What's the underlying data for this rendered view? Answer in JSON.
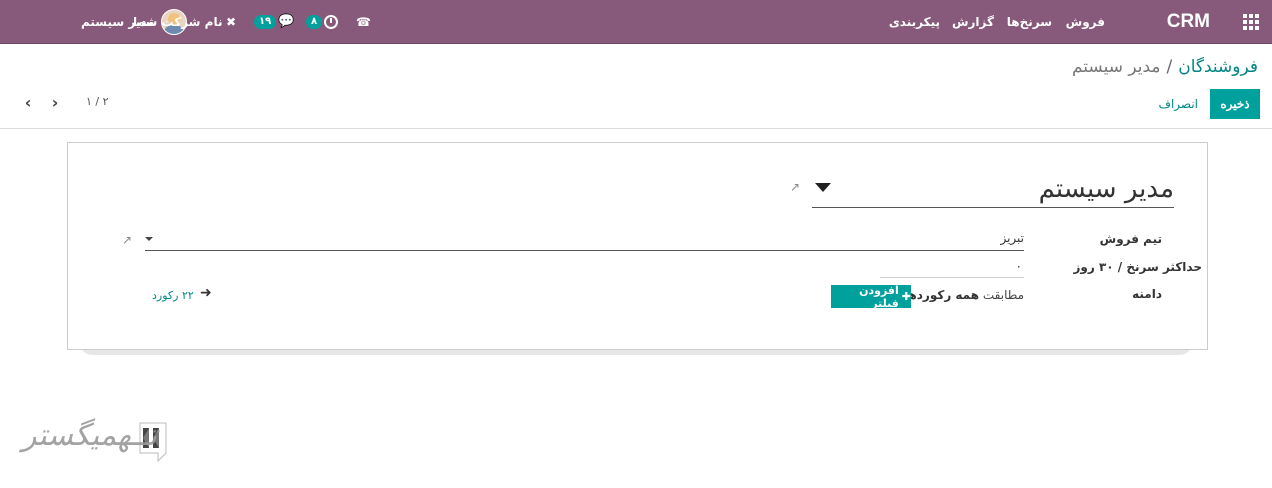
{
  "navbar": {
    "brand": "CRM",
    "menu": [
      "فروش",
      "سرنخ‌ها",
      "گزارش",
      "پیکربندی"
    ],
    "user_name": "مدیر سیستم",
    "company_name": "نام شرکت شما",
    "messages_badge": "۱۹",
    "activities_badge": "۸",
    "colors": {
      "bar": "#875a7b",
      "badge": "#00a09d"
    }
  },
  "breadcrumb": {
    "parent": "فروشندگان",
    "separator": "/",
    "current": "مدیر سیستم"
  },
  "buttons": {
    "save": "ذخیره",
    "discard": "انصراف"
  },
  "pager": {
    "value": "۱ / ۲"
  },
  "form": {
    "name": "مدیر سیستم",
    "fields": {
      "sales_team_label": "تیم فروش",
      "sales_team_value": "تبریز",
      "max_leads_label": "حداکثر سرنخ / ۳۰ روز",
      "max_leads_value": "۰",
      "domain_label": "دامنه"
    },
    "domain": {
      "prefix": "مطابقت",
      "all_records": "همه رکوردها",
      "add_filter": "افزودن فیلتر",
      "records_count": "۲۲ رکورد"
    }
  },
  "watermark": {
    "text": "تــهمیگستر"
  },
  "icons": [
    "apps-grid-icon",
    "phone-icon",
    "clock-icon",
    "chat-icon",
    "tools-icon",
    "external-link-icon",
    "caret-down-icon",
    "arrow-right-icon",
    "chevron-left-icon",
    "chevron-right-icon",
    "plus-icon"
  ]
}
